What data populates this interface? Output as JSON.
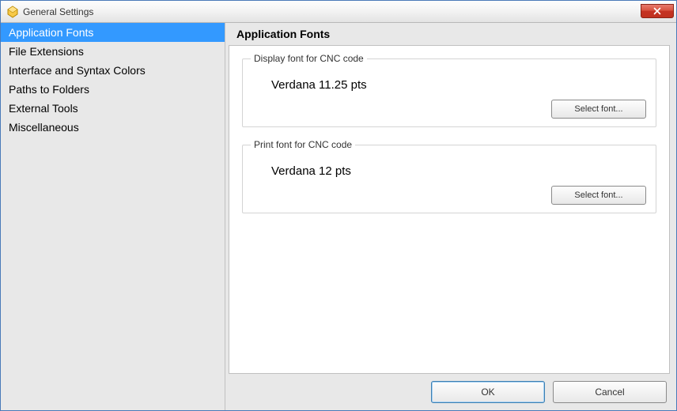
{
  "window": {
    "title": "General Settings"
  },
  "sidebar": {
    "items": [
      {
        "label": "Application Fonts",
        "selected": true
      },
      {
        "label": "File Extensions",
        "selected": false
      },
      {
        "label": "Interface and Syntax Colors",
        "selected": false
      },
      {
        "label": "Paths to Folders",
        "selected": false
      },
      {
        "label": "External Tools",
        "selected": false
      },
      {
        "label": "Miscellaneous",
        "selected": false
      }
    ]
  },
  "panel": {
    "header": "Application Fonts",
    "group1": {
      "legend": "Display font for CNC code",
      "value": "Verdana 11.25 pts",
      "button": "Select font..."
    },
    "group2": {
      "legend": "Print font for CNC code",
      "value": "Verdana 12 pts",
      "button": "Select font..."
    }
  },
  "buttons": {
    "ok": "OK",
    "cancel": "Cancel"
  }
}
